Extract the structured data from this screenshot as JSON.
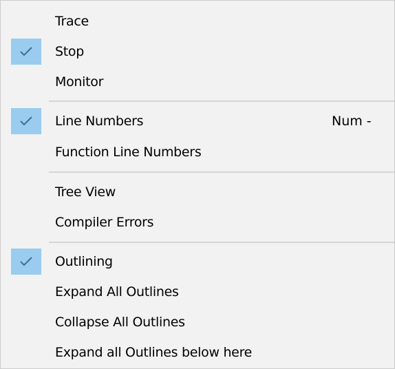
{
  "menu": {
    "items": [
      {
        "label": "Trace",
        "checked": false,
        "shortcut": ""
      },
      {
        "label": "Stop",
        "checked": true,
        "shortcut": ""
      },
      {
        "label": "Monitor",
        "checked": false,
        "shortcut": ""
      },
      {
        "label": "Line Numbers",
        "checked": true,
        "shortcut": "Num -"
      },
      {
        "label": "Function Line Numbers",
        "checked": false,
        "shortcut": ""
      },
      {
        "label": "Tree View",
        "checked": false,
        "shortcut": ""
      },
      {
        "label": "Compiler Errors",
        "checked": false,
        "shortcut": ""
      },
      {
        "label": "Outlining",
        "checked": true,
        "shortcut": ""
      },
      {
        "label": "Expand All Outlines",
        "checked": false,
        "shortcut": ""
      },
      {
        "label": "Collapse All Outlines",
        "checked": false,
        "shortcut": ""
      },
      {
        "label": "Expand all Outlines below here",
        "checked": false,
        "shortcut": ""
      }
    ],
    "check_icon": "check-icon",
    "check_highlight_color": "#99ccee"
  }
}
